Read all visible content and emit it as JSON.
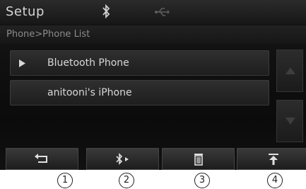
{
  "header": {
    "title": "Setup",
    "status_icons": [
      "bluetooth-icon",
      "usb-icon"
    ]
  },
  "breadcrumb": "Phone>Phone List",
  "phone_list": {
    "items": [
      {
        "label": "Bluetooth Phone",
        "icon": "play-icon",
        "selected": true
      },
      {
        "label": "anitooni's iPhone",
        "icon": null,
        "selected": false
      }
    ]
  },
  "scroll_buttons": [
    "scroll-up-icon",
    "scroll-down-icon"
  ],
  "bottom_buttons": [
    {
      "icon": "back-icon",
      "callout": "1"
    },
    {
      "icon": "bluetooth-connect-icon",
      "callout": "2"
    },
    {
      "icon": "trash-icon",
      "callout": "3"
    },
    {
      "icon": "priority-up-icon",
      "callout": "4"
    }
  ],
  "callouts": [
    "1",
    "2",
    "3",
    "4"
  ],
  "colors": {
    "screen_bg": "#111111",
    "text": "#d8d8d8",
    "muted": "#8b8b8b"
  }
}
